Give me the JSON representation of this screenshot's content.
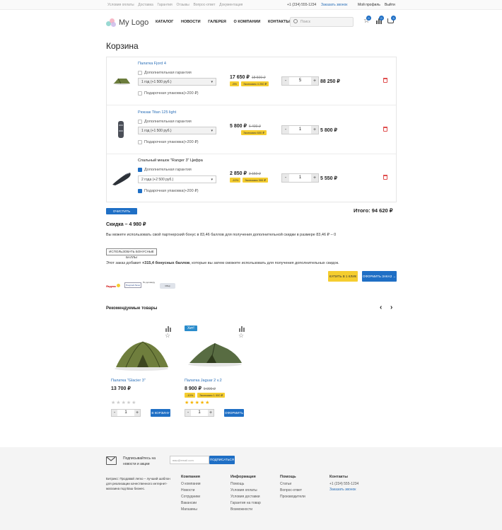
{
  "topbar": {
    "links": [
      "Условия оплаты",
      "Доставка",
      "Гарантия",
      "Отзывы",
      "Вопрос-ответ",
      "Документация"
    ],
    "phone": "+1 (234) 555-1234",
    "callback": "Заказать звонок",
    "profile": "Мой профиль",
    "logout": "Выйти"
  },
  "header": {
    "logo": "My Logo",
    "nav": [
      "КАТАЛОГ",
      "НОВОСТИ",
      "ГАЛЕРЕЯ",
      "О КОМПАНИИ",
      "КОНТАКТЫ"
    ],
    "search_placeholder": "Поиск",
    "badges": {
      "favorites": "0",
      "compare": "0",
      "cart": "3"
    }
  },
  "page_title": "Корзина",
  "cart": {
    "items": [
      {
        "name": "Палатка Fjord 4",
        "warranty_label": "Дополнительная гарантия",
        "warranty_checked": false,
        "warranty_select": "1 год (+1 500 руб.)",
        "gift_label": "Подарочная упаковка(+200 ₽)",
        "gift_checked": false,
        "price": "17 650 ₽",
        "old_price": "18 500 ₽",
        "discount": "-5%",
        "saving": "Экономия 4 250 ₽",
        "qty": "5",
        "total": "88 250 ₽"
      },
      {
        "name": "Рюкзак Titan 125 light",
        "warranty_label": "Дополнительная гарантия",
        "warranty_checked": false,
        "warranty_select": "1 год (+1 500 руб.)",
        "gift_label": "Подарочная упаковка(+200 ₽)",
        "gift_checked": false,
        "price": "5 800 ₽",
        "old_price": "6 400 ₽",
        "discount": "",
        "saving": "Экономия 600 ₽",
        "qty": "1",
        "total": "5 800 ₽"
      },
      {
        "name": "Спальный мешок \"Ranger 3\" Цифра",
        "warranty_label": "Дополнительная гарантия",
        "warranty_checked": true,
        "warranty_select": "2 года (+2 500 руб.)",
        "gift_label": "Подарочная упаковка(+200 ₽)",
        "gift_checked": true,
        "price": "2 850 ₽",
        "old_price": "3 150 ₽",
        "discount": "-10%",
        "saving": "Экономия 300 ₽",
        "qty": "1",
        "total": "5 550 ₽"
      }
    ],
    "clear_button": "ОЧИСТИТЬ КОРЗИНУ",
    "total_label": "Итого: 94 620 ₽",
    "discount_label": "Скидка – 4 980 ₽",
    "bonus_text": "Вы можете использовать свой партнерский бонус в 83,46 баллов для получения дополнительной скидки в размере 83,46 ₽ – 0",
    "use_bonus_button": "ИСПОЛЬЗОВАТЬ БОНУСНЫЕ БАЛЛЫ",
    "bonus_add_prefix": "Этот заказ добавит",
    "bonus_add_bold": "+315,4 бонусных баллов",
    "bonus_add_suffix": ", которые вы затем сможете использовать для получения дополнительных скидок.",
    "one_click_button": "КУПИТЬ В 1 КЛИК",
    "checkout_button": "ОФОРМИТЬ ЗАКАЗ →",
    "payment_logos": [
      "Яндекс",
      "Покупай Легко",
      "По договору",
      "Сбер"
    ]
  },
  "recommended": {
    "title": "Рекомендуемые товары",
    "products": [
      {
        "name": "Палатка \"Glacier 3\"",
        "price": "13 700 ₽",
        "old_price": "",
        "badge": "",
        "discount": "",
        "saving": "",
        "rating": 0,
        "qty": "1",
        "button": "В КОРЗИНУ"
      },
      {
        "name": "Палатка Jaguar 2 v.2",
        "price": "8 900 ₽",
        "old_price": "9 900 ₽",
        "badge": "Хит!",
        "discount": "-10%",
        "saving": "Экономия 1 000 ₽",
        "rating": 5,
        "qty": "1",
        "button": "ОФОРМИТЬ"
      }
    ]
  },
  "footer": {
    "subscribe_text": "Подписывайтесь на новости и акции",
    "subscribe_placeholder": "ваш@email.com",
    "subscribe_button": "ПОДПИСАТЬСЯ",
    "about": "Битрикс: Продавай легко – лучший шаблон для реализации качественного интернет-магазина под Ваш бизнес.",
    "columns": [
      {
        "title": "Компания",
        "links": [
          "О компании",
          "Новости",
          "Сотрудники",
          "Вакансии",
          "Магазины"
        ]
      },
      {
        "title": "Информация",
        "links": [
          "Помощь",
          "Условия оплаты",
          "Условия доставки",
          "Гарантия на товар",
          "Возможности"
        ]
      },
      {
        "title": "Помощь",
        "links": [
          "Статьи",
          "Вопрос-ответ",
          "Производители"
        ]
      },
      {
        "title": "Контакты",
        "links": [
          "+1 (234) 555-1234",
          "Заказать звонок"
        ]
      }
    ]
  }
}
